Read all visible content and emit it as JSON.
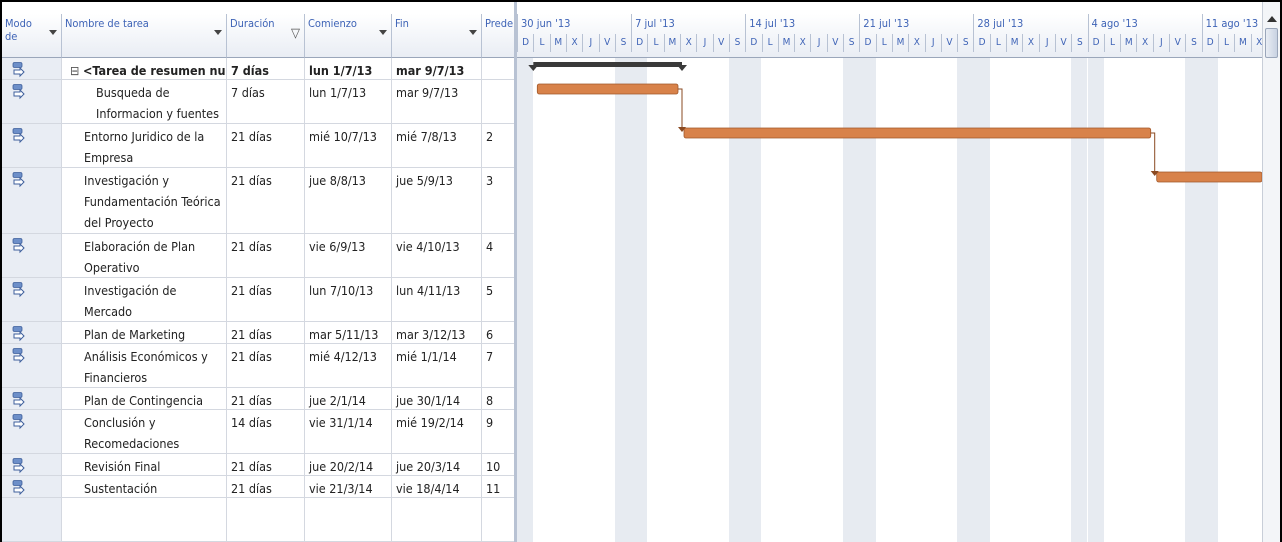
{
  "columns": {
    "mode": "Modo de",
    "name": "Nombre de tarea",
    "duration": "Duración",
    "start": "Comienzo",
    "end": "Fin",
    "pred": "Prede"
  },
  "tasks": [
    {
      "name": "<Tarea de resumen nuev",
      "duration": "7 días",
      "start": "lun 1/7/13",
      "end": "mar 9/7/13",
      "pred": "",
      "summary": true
    },
    {
      "name": "Busqueda de Informacion y fuentes",
      "duration": "7 días",
      "start": "lun 1/7/13",
      "end": "mar 9/7/13",
      "pred": ""
    },
    {
      "name": "Entorno Juridico de la Empresa",
      "duration": "21 días",
      "start": "mié 10/7/13",
      "end": "mié 7/8/13",
      "pred": "2"
    },
    {
      "name": "Investigación y Fundamentación Teórica del Proyecto",
      "duration": "21 días",
      "start": "jue 8/8/13",
      "end": "jue 5/9/13",
      "pred": "3"
    },
    {
      "name": "Elaboración de Plan Operativo",
      "duration": "21 días",
      "start": "vie 6/9/13",
      "end": "vie 4/10/13",
      "pred": "4"
    },
    {
      "name": "Investigación de Mercado",
      "duration": "21 días",
      "start": "lun 7/10/13",
      "end": "lun 4/11/13",
      "pred": "5"
    },
    {
      "name": "Plan de Marketing",
      "duration": "21 días",
      "start": "mar 5/11/13",
      "end": "mar 3/12/13",
      "pred": "6"
    },
    {
      "name": "Análisis Económicos y Financieros",
      "duration": "21 días",
      "start": "mié 4/12/13",
      "end": "mié 1/1/14",
      "pred": "7"
    },
    {
      "name": "Plan de Contingencia",
      "duration": "21 días",
      "start": "jue 2/1/14",
      "end": "jue 30/1/14",
      "pred": "8"
    },
    {
      "name": "Conclusión y Recomedaciones",
      "duration": "14 días",
      "start": "vie 31/1/14",
      "end": "mié 19/2/14",
      "pred": "9"
    },
    {
      "name": "Revisión Final",
      "duration": "21 días",
      "start": "jue 20/2/14",
      "end": "jue 20/3/14",
      "pred": "10"
    },
    {
      "name": "Sustentación",
      "duration": "21 días",
      "start": "vie 21/3/14",
      "end": "vie 18/4/14",
      "pred": "11"
    }
  ],
  "timescale": {
    "weeks": [
      "30 jun '13",
      "7 jul '13",
      "14 jul '13",
      "21 jul '13",
      "28 jul '13",
      "4 ago '13",
      "11 ago '13"
    ],
    "days": [
      "D",
      "L",
      "M",
      "X",
      "J",
      "V",
      "S"
    ]
  },
  "colors": {
    "bar": "#d8824a",
    "summary": "#3a3a3a",
    "header_text": "#3e63b6"
  },
  "icons": {
    "task_mode": "auto-scheduled-task-icon",
    "collapse": "collapse-minus-icon",
    "filter": "filter-funnel-icon",
    "dropdown": "chevron-down-icon"
  }
}
